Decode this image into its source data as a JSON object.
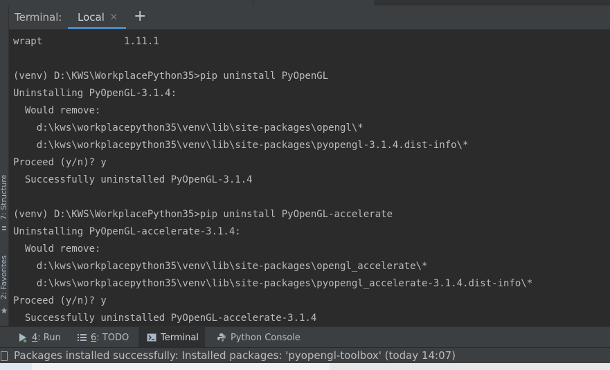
{
  "tabbar": {
    "title": "Terminal:",
    "active_tab": "Local",
    "close_glyph": "×",
    "add_glyph": "+"
  },
  "left_stripe": {
    "structure_label": "7: Structure",
    "favorites_label": "2: Favorites"
  },
  "terminal": {
    "lines": [
      "wrapt              1.11.1",
      "",
      "(venv) D:\\KWS\\WorkplacePython35>pip uninstall PyOpenGL",
      "Uninstalling PyOpenGL-3.1.4:",
      "  Would remove:",
      "    d:\\kws\\workplacepython35\\venv\\lib\\site-packages\\opengl\\*",
      "    d:\\kws\\workplacepython35\\venv\\lib\\site-packages\\pyopengl-3.1.4.dist-info\\*",
      "Proceed (y/n)? y",
      "  Successfully uninstalled PyOpenGL-3.1.4",
      "",
      "(venv) D:\\KWS\\WorkplacePython35>pip uninstall PyOpenGL-accelerate",
      "Uninstalling PyOpenGL-accelerate-3.1.4:",
      "  Would remove:",
      "    d:\\kws\\workplacepython35\\venv\\lib\\site-packages\\opengl_accelerate\\*",
      "    d:\\kws\\workplacepython35\\venv\\lib\\site-packages\\pyopengl_accelerate-3.1.4.dist-info\\*",
      "Proceed (y/n)? y",
      "  Successfully uninstalled PyOpenGL-accelerate-3.1.4"
    ]
  },
  "toolwindows": {
    "run_num": "4",
    "run_label": ": Run",
    "todo_num": "6",
    "todo_label": ": TODO",
    "terminal_label": "Terminal",
    "python_console_label": "Python Console"
  },
  "status": {
    "message": "Packages installed successfully: Installed packages: 'pyopengl-toolbox' (today 14:07)"
  },
  "colors": {
    "background": "#2b2b2b",
    "panel": "#3c3f41",
    "accent": "#4a88c7",
    "text": "#bbbbbb"
  },
  "icons": {
    "run": "run-icon",
    "todo": "todo-list-icon",
    "terminal": "terminal-icon",
    "python_console": "python-console-icon",
    "favorites": "star-icon",
    "structure": "structure-icon",
    "status": "event-log-icon"
  }
}
